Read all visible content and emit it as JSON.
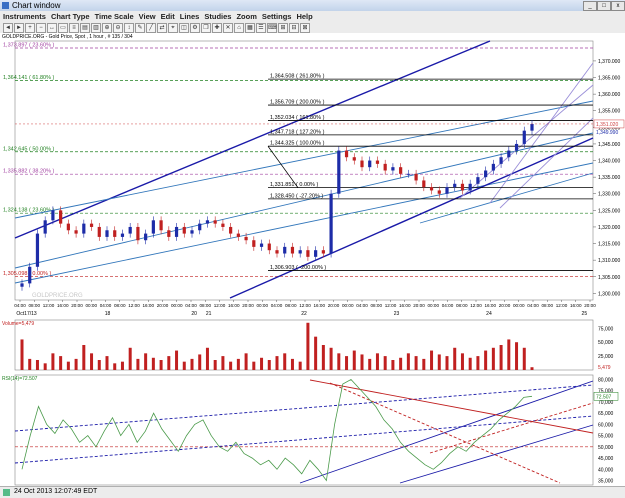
{
  "window": {
    "title": "Chart window",
    "min": "_",
    "max": "□",
    "close": "x"
  },
  "menu": [
    "Instruments",
    "Chart Type",
    "Time Scale",
    "View",
    "Edit",
    "Lines",
    "Studies",
    "Zoom",
    "Settings",
    "Help"
  ],
  "toolbar": [
    "◄",
    "►",
    "+",
    "−",
    "↔",
    "▭",
    "≡",
    "▤",
    "▥",
    "⊕",
    "⊖",
    "↕",
    "✎",
    "╱",
    "⇄",
    "⌖",
    "◫",
    "⚙",
    "❐",
    "✚",
    "✕",
    "⌂",
    "▦",
    "☰",
    "⌨",
    "⊞",
    "⊟",
    "⊠"
  ],
  "chart": {
    "instrument_label": "GOLDPRICE.ORG - Gold Price, Spot , 1 hour , # 135 / 304",
    "watermark": "GOLDPRICE.ORG",
    "y_ticks": [
      "1,370.000",
      "1,365.000",
      "1,360.000",
      "1,355.000",
      "1,350.000",
      "1,345.000",
      "1,340.000",
      "1,335.000",
      "1,330.000",
      "1,325.000",
      "1,320.000",
      "1,315.000",
      "1,310.000",
      "1,305.000",
      "1,300.000"
    ],
    "current_price": "1,351.020",
    "current_price_value": 1351.02,
    "second_price_label": "1,349.990",
    "fib_left": [
      {
        "label": "1,373.897 ( 23.60% )",
        "value": 1373.897,
        "color": "#a040a0"
      },
      {
        "label": "1,364.141 ( 61.80% )",
        "value": 1364.141,
        "color": "#208020"
      },
      {
        "label": "1,342.645 ( 50.00% )",
        "value": 1342.645,
        "color": "#208020"
      },
      {
        "label": "1,335.882 ( 38.20% )",
        "value": 1335.882,
        "color": "#a040a0"
      },
      {
        "label": "1,324.138 ( 23.60% )",
        "value": 1324.138,
        "color": "#208020"
      },
      {
        "label": "1,305.098 ( 0.00% )",
        "value": 1305.098,
        "color": "#c02020"
      }
    ],
    "fib_right": [
      {
        "label": "1,364.508 ( 261.80% )",
        "value": 1364.508
      },
      {
        "label": "1,356.709 ( 200.00% )",
        "value": 1356.709
      },
      {
        "label": "1,352.034 ( 161.80% )",
        "value": 1352.034
      },
      {
        "label": "1,347.718 ( 127.20% )",
        "value": 1347.718
      },
      {
        "label": "1,344.325 ( 100.00% )",
        "value": 1344.325
      },
      {
        "label": "1,331.851 ( 0.00% )",
        "value": 1331.851
      },
      {
        "label": "1,328.450 ( -27.20% )",
        "value": 1328.45
      },
      {
        "label": "1,306.903 ( -200.00% )",
        "value": 1306.903
      }
    ],
    "x_time_labels": [
      "04:00",
      "08:00",
      "12:00",
      "16:00",
      "20:00",
      "00:00",
      "04:00",
      "08:00",
      "12:00",
      "16:00",
      "20:00",
      "00:00",
      "04:00",
      "08:00",
      "12:00",
      "16:00",
      "20:00",
      "00:00",
      "04:00",
      "08:00",
      "12:00",
      "16:00",
      "20:00",
      "00:00",
      "04:00",
      "08:00",
      "12:00",
      "16:00",
      "20:00",
      "00:00",
      "04:00",
      "08:00",
      "12:00",
      "16:00",
      "20:00",
      "00:00",
      "04:00",
      "08:00",
      "12:00",
      "16:00",
      "20:00"
    ],
    "x_date_labels": [
      {
        "label": "Oct17/13",
        "pos": 0.02
      },
      {
        "label": "18",
        "pos": 0.16
      },
      {
        "label": "20",
        "pos": 0.31
      },
      {
        "label": "21",
        "pos": 0.335
      },
      {
        "label": "22",
        "pos": 0.5
      },
      {
        "label": "23",
        "pos": 0.66
      },
      {
        "label": "24",
        "pos": 0.82
      },
      {
        "label": "25",
        "pos": 0.985
      }
    ],
    "closes": [
      1303,
      1308,
      1318,
      1322,
      1325,
      1321,
      1319,
      1318,
      1321,
      1320,
      1317,
      1319,
      1317,
      1318,
      1320,
      1316,
      1318,
      1322,
      1319,
      1317,
      1320,
      1318,
      1319,
      1321,
      1322,
      1321,
      1320,
      1318,
      1317,
      1316,
      1314,
      1315,
      1313,
      1312,
      1314,
      1312,
      1313,
      1311,
      1313,
      1312,
      1330,
      1343,
      1341,
      1340,
      1338,
      1340,
      1339,
      1337,
      1338,
      1336,
      1336,
      1334,
      1332,
      1331,
      1330,
      1332,
      1333,
      1331,
      1333,
      1335,
      1337,
      1339,
      1341,
      1343,
      1345,
      1349,
      1351
    ]
  },
  "volume": {
    "label": "Volume=5,479",
    "y_ticks": [
      "75,000",
      "50,000",
      "25,000",
      "5,479"
    ],
    "ymax": 90000,
    "values": [
      55,
      20,
      18,
      12,
      30,
      25,
      15,
      20,
      45,
      30,
      18,
      25,
      12,
      15,
      40,
      20,
      30,
      22,
      18,
      25,
      35,
      15,
      20,
      28,
      40,
      18,
      25,
      15,
      20,
      30,
      15,
      22,
      18,
      25,
      30,
      20,
      15,
      85,
      60,
      45,
      40,
      30,
      25,
      35,
      28,
      20,
      30,
      25,
      18,
      22,
      30,
      25,
      20,
      35,
      28,
      25,
      40,
      30,
      22,
      25,
      35,
      40,
      45,
      55,
      50,
      40,
      5
    ]
  },
  "rsi": {
    "label": "RSI(14)=72.507",
    "y_ticks": [
      "80,000",
      "75,000",
      "70,000",
      "65,000",
      "60,000",
      "55,000",
      "50,000",
      "45,000",
      "40,000",
      "35,000"
    ],
    "value_label": "72.507",
    "values": [
      40,
      55,
      68,
      60,
      56,
      62,
      58,
      52,
      55,
      50,
      57,
      63,
      55,
      60,
      52,
      57,
      65,
      58,
      53,
      48,
      55,
      60,
      62,
      55,
      50,
      48,
      52,
      47,
      45,
      42,
      44,
      40,
      45,
      42,
      38,
      44,
      40,
      35,
      60,
      78,
      80,
      76,
      72,
      68,
      62,
      58,
      52,
      48,
      45,
      42,
      40,
      43,
      47,
      50,
      48,
      52,
      55,
      58,
      62,
      65,
      68,
      72,
      72.5
    ]
  },
  "status": {
    "datetime": "24 Oct 2013 12:07:49 EDT"
  }
}
